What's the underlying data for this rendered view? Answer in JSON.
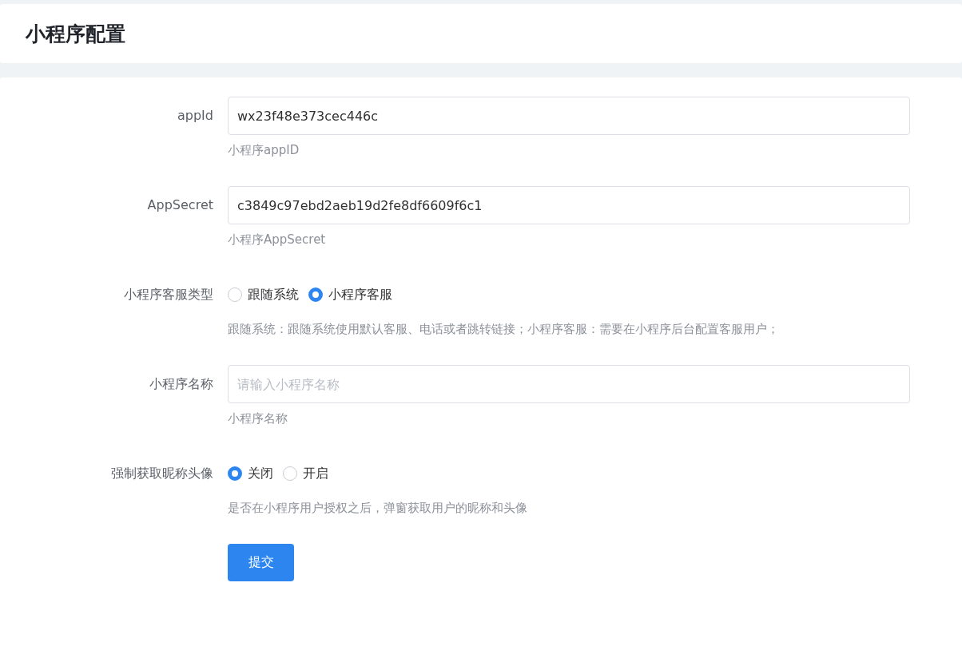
{
  "header": {
    "title": "小程序配置"
  },
  "form": {
    "fields": [
      {
        "kind": "input",
        "label": "appId",
        "value": "wx23f48e373cec446c",
        "help": "小程序appID"
      },
      {
        "kind": "input",
        "label": "AppSecret",
        "value": "c3849c97ebd2aeb19d2fe8df6609f6c1",
        "help": "小程序AppSecret"
      },
      {
        "kind": "radio",
        "label": "小程序客服类型",
        "options": [
          {
            "label": "跟随系统",
            "selected": false
          },
          {
            "label": "小程序客服",
            "selected": true
          }
        ],
        "help": "跟随系统：跟随系统使用默认客服、电话或者跳转链接；小程序客服：需要在小程序后台配置客服用户；"
      },
      {
        "kind": "input",
        "label": "小程序名称",
        "placeholder": "请输入小程序名称",
        "help": "小程序名称"
      },
      {
        "kind": "radio",
        "label": "强制获取昵称头像",
        "options": [
          {
            "label": "关闭",
            "selected": true
          },
          {
            "label": "开启",
            "selected": false
          }
        ],
        "help": "是否在小程序用户授权之后，弹窗获取用户的昵称和头像"
      }
    ],
    "submit": "提交"
  }
}
